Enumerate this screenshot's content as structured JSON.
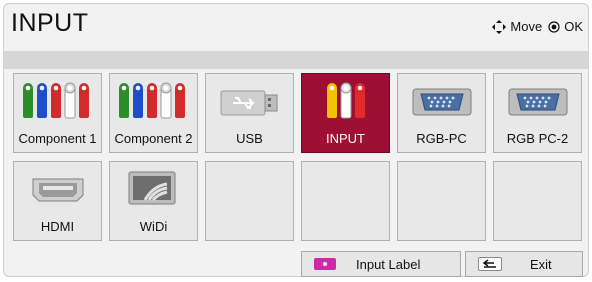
{
  "header": {
    "title": "INPUT",
    "hint_move": "Move",
    "hint_ok": "OK"
  },
  "tiles": [
    {
      "label": "Component 1",
      "icon": "component-rca-icon",
      "selected": false
    },
    {
      "label": "Component 2",
      "icon": "component-rca-icon",
      "selected": false
    },
    {
      "label": "USB",
      "icon": "usb-icon",
      "selected": false
    },
    {
      "label": "INPUT",
      "icon": "av-rca-icon",
      "selected": true
    },
    {
      "label": "RGB-PC",
      "icon": "vga-icon",
      "selected": false
    },
    {
      "label": "RGB PC-2",
      "icon": "vga-icon",
      "selected": false
    },
    {
      "label": "HDMI",
      "icon": "hdmi-icon",
      "selected": false
    },
    {
      "label": "WiDi",
      "icon": "widi-icon",
      "selected": false
    },
    {
      "label": "",
      "icon": "",
      "selected": false
    },
    {
      "label": "",
      "icon": "",
      "selected": false
    },
    {
      "label": "",
      "icon": "",
      "selected": false
    },
    {
      "label": "",
      "icon": "",
      "selected": false
    }
  ],
  "footer": {
    "input_label": "Input Label",
    "exit_label": "Exit"
  },
  "colors": {
    "selected": "#9d1034",
    "magenta_key": "#cc2aa6",
    "gray_bar": "#d6d6d6"
  }
}
